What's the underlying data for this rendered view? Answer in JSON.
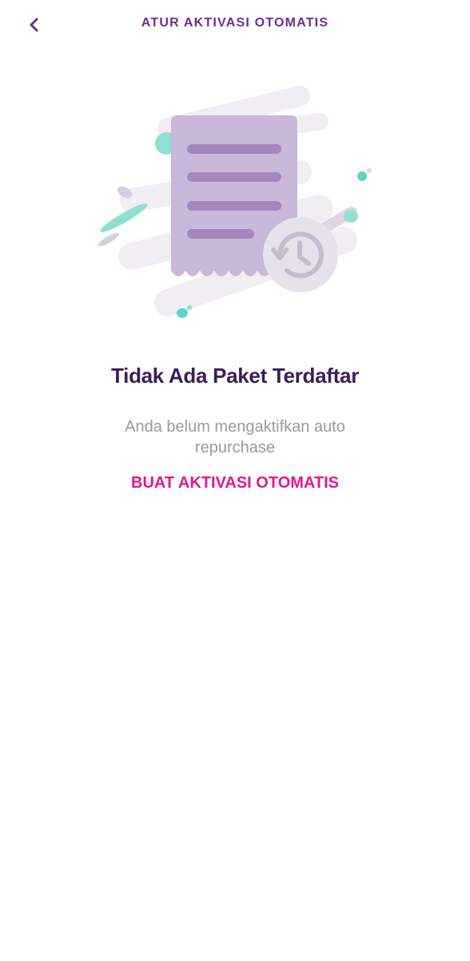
{
  "header": {
    "title": "ATUR AKTIVASI OTOMATIS",
    "back_icon": "chevron-left-icon"
  },
  "empty_state": {
    "illustration_icon": "receipt-history-icon",
    "title": "Tidak Ada Paket Terdaftar",
    "description": "Anda belum mengaktifkan auto repurchase",
    "action_label": "BUAT AKTIVASI OTOMATIS"
  },
  "colors": {
    "accent_purple": "#6c2d91",
    "title_dark_purple": "#3b1d59",
    "cta_pink": "#e5168f",
    "muted_text": "#9a9a9a",
    "receipt_lavender": "#c9b8d9",
    "receipt_lines": "#a487bb",
    "teal_accent": "#5fd4bf"
  }
}
